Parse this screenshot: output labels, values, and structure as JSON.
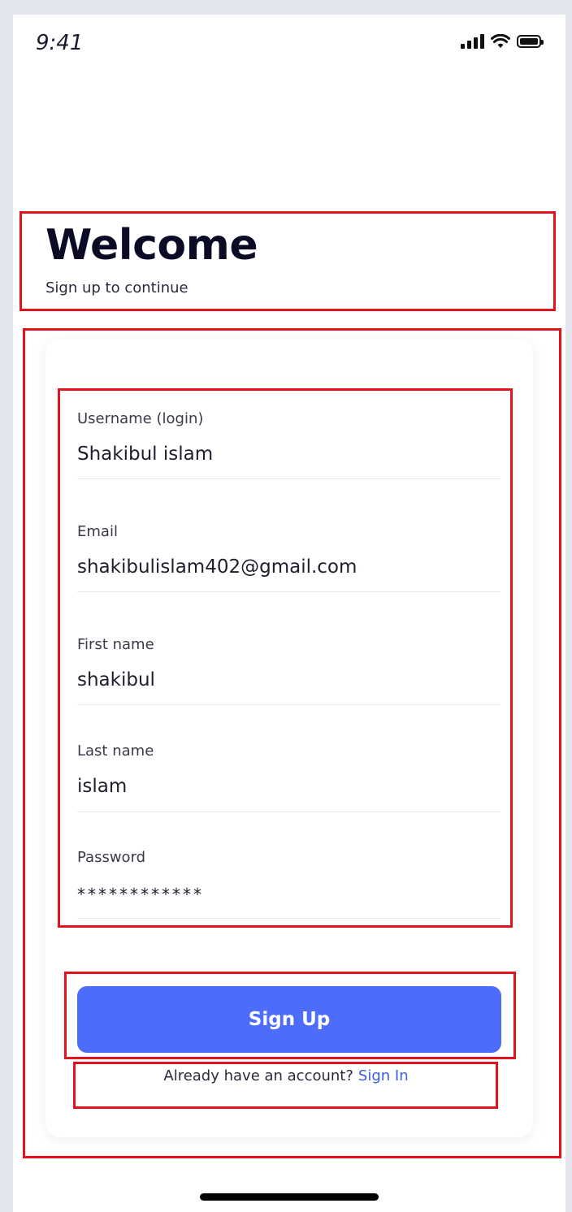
{
  "status_bar": {
    "time": "9:41"
  },
  "header": {
    "title": "Welcome",
    "subtitle": "Sign up to continue"
  },
  "form": {
    "fields": [
      {
        "label": "Username (login)",
        "value": "Shakibul islam"
      },
      {
        "label": "Email",
        "value": "shakibulislam402@gmail.com"
      },
      {
        "label": "First name",
        "value": "shakibul"
      },
      {
        "label": "Last name",
        "value": "islam"
      },
      {
        "label": "Password",
        "value": "************"
      }
    ],
    "submit_label": "Sign Up",
    "signin_prompt": "Already have an account?",
    "signin_link": "Sign In"
  },
  "colors": {
    "primary": "#4d6cfa",
    "link": "#3a5fe6",
    "highlight": "#e2131b",
    "background": "#e3e6ef"
  }
}
